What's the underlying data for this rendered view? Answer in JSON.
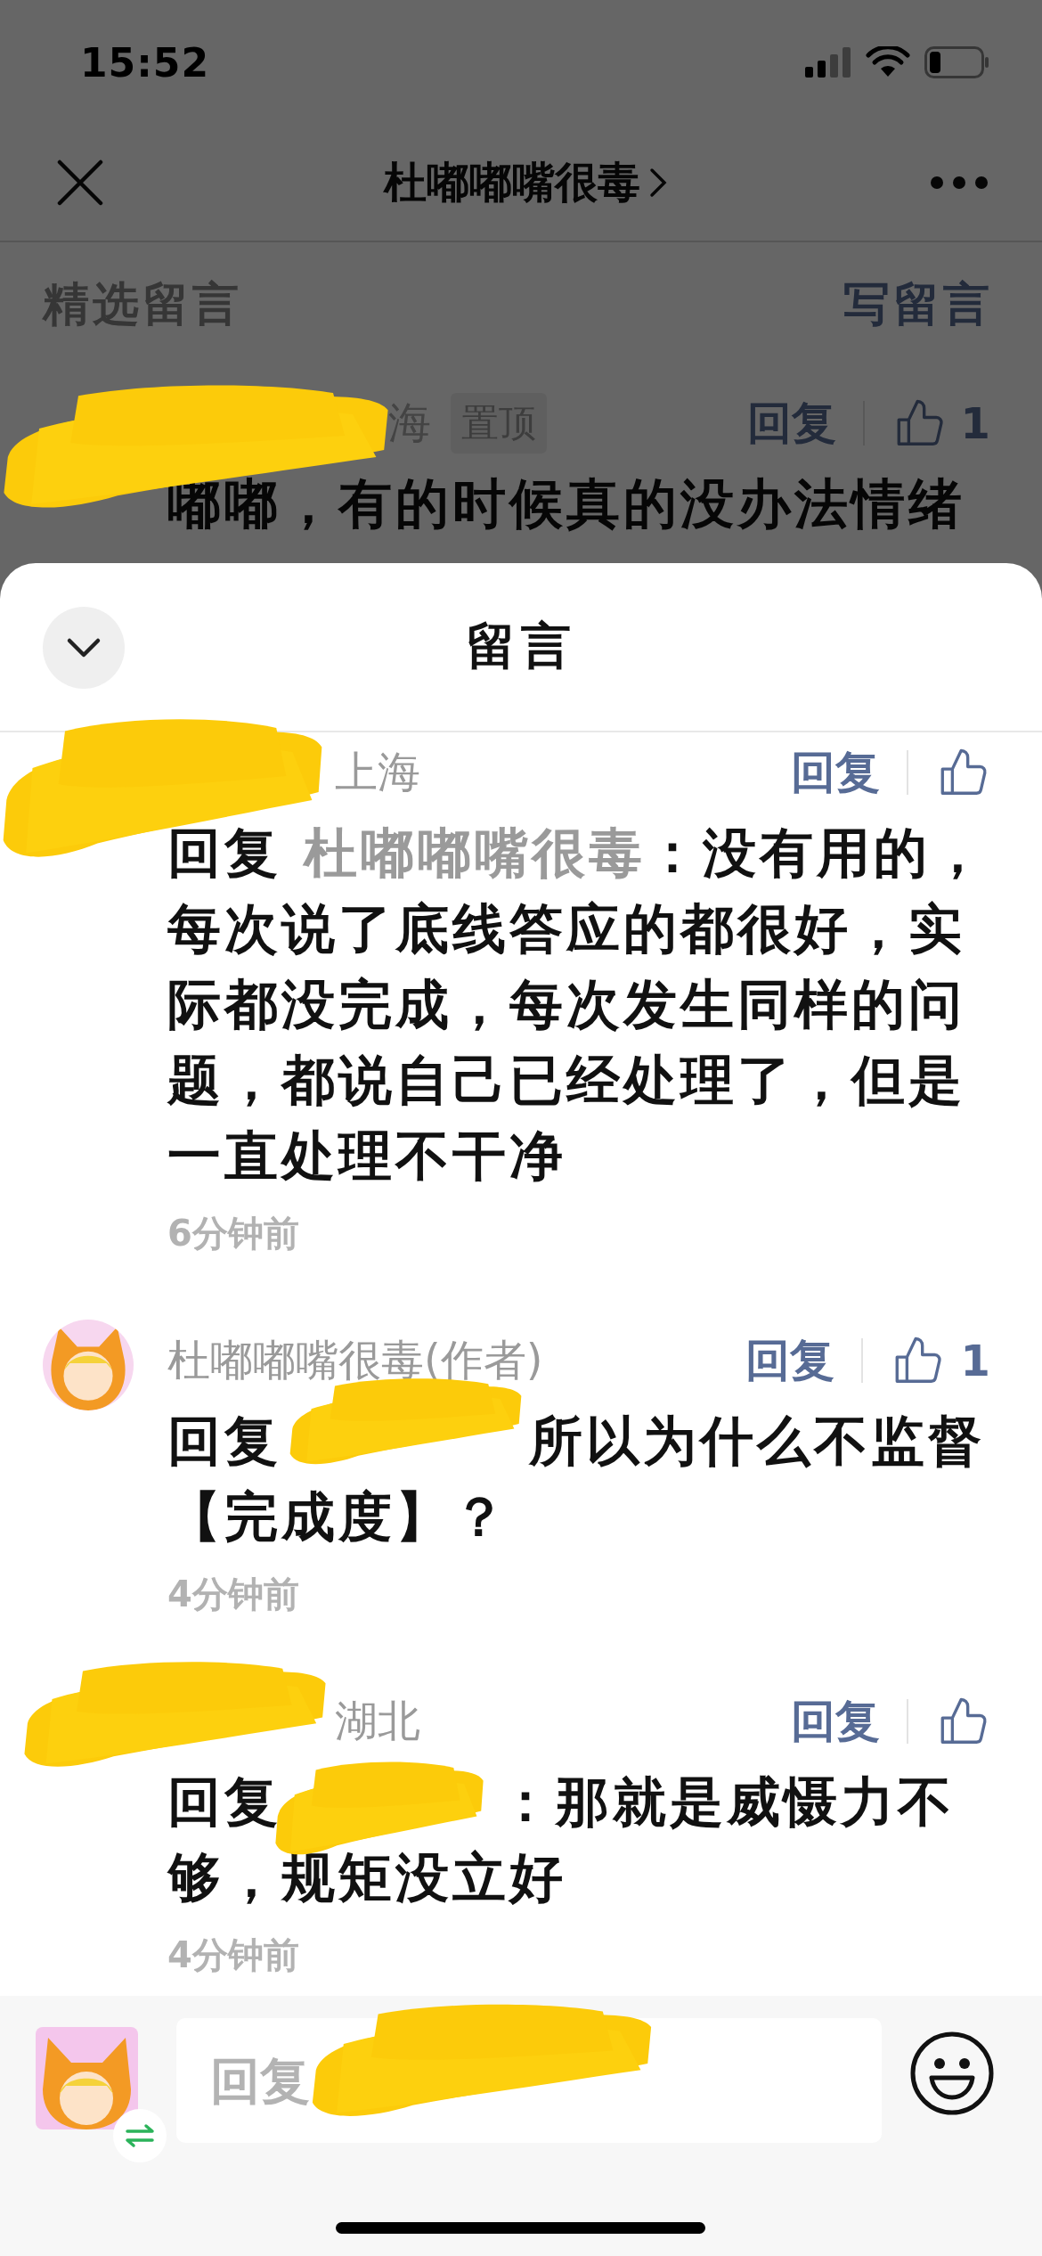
{
  "status_bar": {
    "time": "15:52"
  },
  "nav": {
    "title": "杜嘟嘟嘴很毒"
  },
  "background_page": {
    "section_label": "精选留言",
    "write_link": "写留言",
    "pinned_comment": {
      "author_redacted": true,
      "location": "海",
      "badge": "置顶",
      "reply_label": "回复",
      "likes": "1",
      "text": "嘟嘟，有的时候真的没办法情绪"
    }
  },
  "sheet": {
    "title": "留言",
    "comments": [
      {
        "author_redacted": true,
        "location": "上海",
        "reply_label": "回复",
        "reply_prefix": "回复",
        "reply_to": "杜嘟嘟嘴很毒",
        "reply_to_redacted": false,
        "text": "：没有用的，每次说了底线答应的都很好，实际都没完成，每次发生同样的问题，都说自己已经处理了，但是一直处理不干净",
        "time": "6分钟前"
      },
      {
        "author_redacted": false,
        "author": "杜嘟嘟嘴很毒(作者)",
        "reply_label": "回复",
        "likes": "1",
        "reply_prefix": "回复",
        "reply_to_redacted": true,
        "text": "所以为什么不监督【完成度】？",
        "time": "4分钟前"
      },
      {
        "author_redacted": true,
        "location": "湖北",
        "reply_label": "回复",
        "reply_prefix": "回复",
        "reply_to_redacted": true,
        "text": "：那就是威慑力不够，规矩没立好",
        "time": "4分钟前"
      }
    ]
  },
  "reply_bar": {
    "placeholder": "回复",
    "redacted": true
  }
}
